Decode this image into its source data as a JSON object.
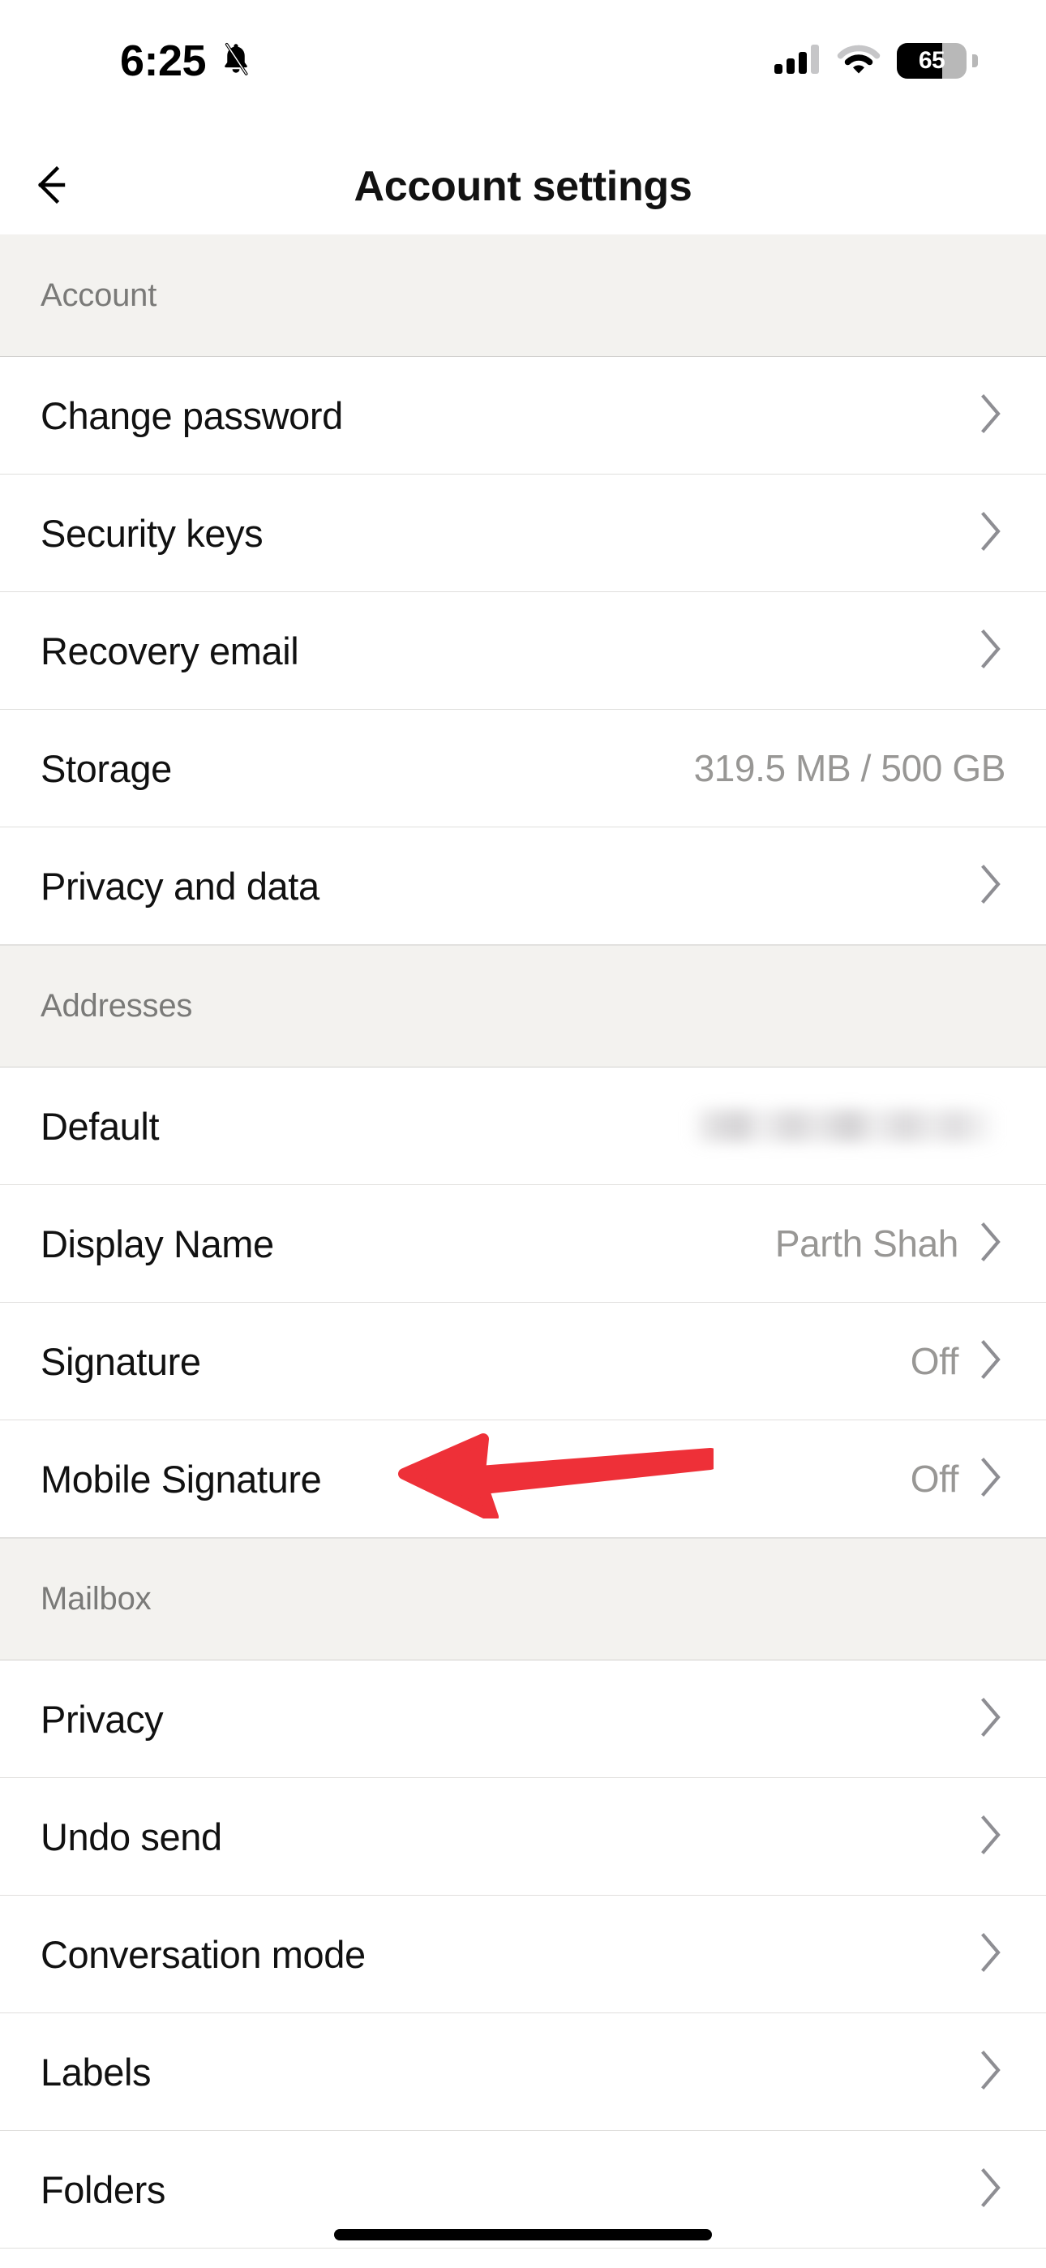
{
  "status_bar": {
    "time": "6:25",
    "silent_icon": "bell-slash-icon",
    "signal_icon": "cellular-signal-icon",
    "signal_bars_filled": 3,
    "signal_bars_total": 4,
    "wifi_icon": "wifi-icon",
    "battery_percent": "65",
    "battery_level": 65
  },
  "header": {
    "back_icon": "back-arrow-icon",
    "title": "Account settings"
  },
  "sections": [
    {
      "title": "Account",
      "rows": [
        {
          "label": "Change password",
          "value": "",
          "chevron": true
        },
        {
          "label": "Security keys",
          "value": "",
          "chevron": true
        },
        {
          "label": "Recovery email",
          "value": "",
          "chevron": true
        },
        {
          "label": "Storage",
          "value": "319.5 MB / 500 GB",
          "chevron": false
        },
        {
          "label": "Privacy and data",
          "value": "",
          "chevron": true
        }
      ]
    },
    {
      "title": "Addresses",
      "rows": [
        {
          "label": "Default",
          "value": "",
          "chevron": false,
          "redacted": true
        },
        {
          "label": "Display Name",
          "value": "Parth Shah",
          "chevron": true
        },
        {
          "label": "Signature",
          "value": "Off",
          "chevron": true
        },
        {
          "label": "Mobile Signature",
          "value": "Off",
          "chevron": true,
          "annotated": true
        }
      ]
    },
    {
      "title": "Mailbox",
      "rows": [
        {
          "label": "Privacy",
          "value": "",
          "chevron": true
        },
        {
          "label": "Undo send",
          "value": "",
          "chevron": true
        },
        {
          "label": "Conversation mode",
          "value": "",
          "chevron": true
        },
        {
          "label": "Labels",
          "value": "",
          "chevron": true
        },
        {
          "label": "Folders",
          "value": "",
          "chevron": true
        }
      ]
    }
  ],
  "annotation": {
    "type": "arrow",
    "direction": "left",
    "color": "#EE3038",
    "points_to": "Mobile Signature"
  },
  "colors": {
    "background": "#FFFFFF",
    "section_header_bg": "#F3F2EF",
    "section_header_text": "#7A7A78",
    "row_label": "#111111",
    "row_value": "#989795",
    "divider": "#E0DFDD",
    "chevron": "#8E8E93",
    "annotation_red": "#EE3038"
  },
  "home_indicator": "home-indicator"
}
